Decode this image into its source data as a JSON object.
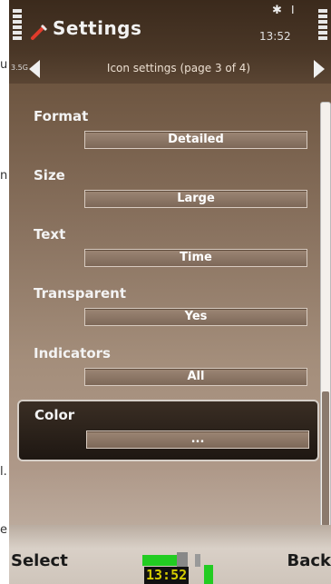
{
  "edge_text": [
    "u",
    "n",
    "l.",
    "e"
  ],
  "status": {
    "title": "Settings",
    "clock": "13:52",
    "bluetooth_icon": "bluetooth-icon",
    "mode_icon": "profile-icon"
  },
  "nav": {
    "badge": "3.5G",
    "title": "Icon settings (page 3 of 4)"
  },
  "settings": [
    {
      "label": "Format",
      "value": "Detailed"
    },
    {
      "label": "Size",
      "value": "Large"
    },
    {
      "label": "Text",
      "value": "Time"
    },
    {
      "label": "Transparent",
      "value": "Yes"
    },
    {
      "label": "Indicators",
      "value": "All"
    },
    {
      "label": "Color",
      "value": "..."
    }
  ],
  "selected_index": 5,
  "softkeys": {
    "left": "Select",
    "right": "Back",
    "widget_time": "13:52"
  },
  "scroll": {
    "position_fraction": 0.68
  }
}
